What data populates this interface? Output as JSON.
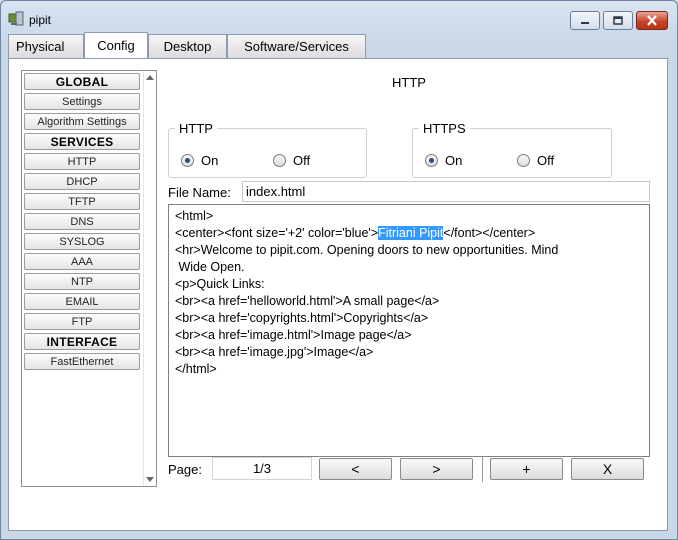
{
  "window": {
    "title": "pipit"
  },
  "tabs": [
    {
      "label": "Physical",
      "active": false
    },
    {
      "label": "Config",
      "active": true
    },
    {
      "label": "Desktop",
      "active": false
    },
    {
      "label": "Software/Services",
      "active": false
    }
  ],
  "sidebar": {
    "items": [
      {
        "label": "GLOBAL",
        "header": true
      },
      {
        "label": "Settings"
      },
      {
        "label": "Algorithm Settings"
      },
      {
        "label": "SERVICES",
        "header": true
      },
      {
        "label": "HTTP"
      },
      {
        "label": "DHCP"
      },
      {
        "label": "TFTP"
      },
      {
        "label": "DNS"
      },
      {
        "label": "SYSLOG"
      },
      {
        "label": "AAA"
      },
      {
        "label": "NTP"
      },
      {
        "label": "EMAIL"
      },
      {
        "label": "FTP"
      },
      {
        "label": "INTERFACE",
        "header": true
      },
      {
        "label": "FastEthernet"
      }
    ]
  },
  "main": {
    "heading": "HTTP",
    "http_group": {
      "legend": "HTTP",
      "on_label": "On",
      "off_label": "Off",
      "selected": "On"
    },
    "https_group": {
      "legend": "HTTPS",
      "on_label": "On",
      "off_label": "Off",
      "selected": "On"
    },
    "file_name_label": "File Name:",
    "file_name_value": "index.html",
    "editor": {
      "lines": [
        "<html>",
        {
          "before": "<center><font size='+2' color='blue'>",
          "selected": "Fitriani Pipit",
          "after": "</font></center>"
        },
        "<hr>Welcome to pipit.com. Opening doors to new opportunities. Mind",
        " Wide Open.",
        "<p>Quick Links:",
        "<br><a href='helloworld.html'>A small page</a>",
        "<br><a href='copyrights.html'>Copyrights</a>",
        "<br><a href='image.html'>Image page</a>",
        "<br><a href='image.jpg'>Image</a>",
        "</html>"
      ]
    },
    "pager": {
      "page_label": "Page:",
      "page_value": "1/3",
      "prev_label": "<",
      "next_label": ">",
      "add_label": "+",
      "delete_label": "X"
    }
  },
  "colors": {
    "selection": "#3399ff",
    "window_bg": "#cfdbe9",
    "close_button": "#c8452b"
  }
}
